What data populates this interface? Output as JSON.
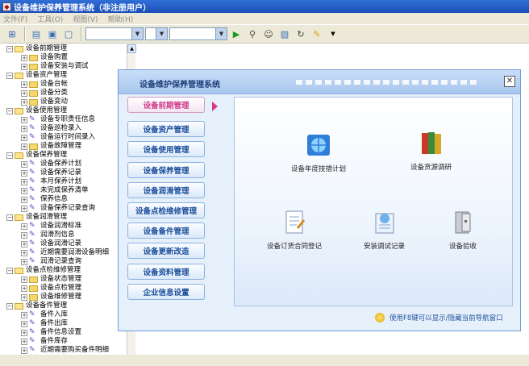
{
  "window": {
    "title": "设备维护保养管理系统（非注册用户）"
  },
  "menu": [
    "文件(F)",
    "工具(O)",
    "视图(V)",
    "帮助(H)"
  ],
  "toolbar": {
    "icons": [
      "tree-toggle-icon",
      "panel-icon",
      "window-icon",
      "monitor-icon",
      "play-icon",
      "user-search-icon",
      "users-icon",
      "photo-icon",
      "refresh-icon",
      "edit-icon"
    ]
  },
  "tree": [
    {
      "level": 0,
      "label": "设备前期管理",
      "open": true
    },
    {
      "level": 1,
      "label": "设备购置"
    },
    {
      "level": 1,
      "label": "设备安装与调试"
    },
    {
      "level": 0,
      "label": "设备资产管理",
      "open": true
    },
    {
      "level": 1,
      "label": "设备台帐"
    },
    {
      "level": 1,
      "label": "设备分类"
    },
    {
      "level": 1,
      "label": "设备变动"
    },
    {
      "level": 0,
      "label": "设备使用管理",
      "open": true
    },
    {
      "level": 1,
      "label": "设备专职责任信息",
      "pen": true
    },
    {
      "level": 1,
      "label": "设备巡检录入",
      "pen": true
    },
    {
      "level": 1,
      "label": "设备运行时间录入",
      "pen": true
    },
    {
      "level": 1,
      "label": "设备故障管理"
    },
    {
      "level": 0,
      "label": "设备保养管理",
      "open": true
    },
    {
      "level": 1,
      "label": "设备保养计划",
      "pen": true
    },
    {
      "level": 1,
      "label": "设备保养记录",
      "pen": true
    },
    {
      "level": 1,
      "label": "本月保养计划",
      "pen": true
    },
    {
      "level": 1,
      "label": "未完成保养清单",
      "pen": true
    },
    {
      "level": 1,
      "label": "保养信息",
      "pen": true
    },
    {
      "level": 1,
      "label": "设备保养记录查询",
      "pen": true
    },
    {
      "level": 0,
      "label": "设备润滑管理",
      "open": true
    },
    {
      "level": 1,
      "label": "设备润滑标准",
      "pen": true
    },
    {
      "level": 1,
      "label": "润滑剂信息",
      "pen": true
    },
    {
      "level": 1,
      "label": "设备润滑记录",
      "pen": true
    },
    {
      "level": 1,
      "label": "近期需要润滑设备明细",
      "pen": true
    },
    {
      "level": 1,
      "label": "润滑记录查询",
      "pen": true
    },
    {
      "level": 0,
      "label": "设备点检维修管理",
      "open": true
    },
    {
      "level": 1,
      "label": "设备状态管理"
    },
    {
      "level": 1,
      "label": "设备点检管理"
    },
    {
      "level": 1,
      "label": "设备维修管理"
    },
    {
      "level": 0,
      "label": "设备备件管理",
      "open": true
    },
    {
      "level": 1,
      "label": "备件入库",
      "pen": true
    },
    {
      "level": 1,
      "label": "备件出库",
      "pen": true
    },
    {
      "level": 1,
      "label": "备件信息设置",
      "pen": true
    },
    {
      "level": 1,
      "label": "备件库存",
      "pen": true
    },
    {
      "level": 1,
      "label": "近期需要购买备件明细",
      "pen": true
    },
    {
      "level": 0,
      "label": "设备更新改造",
      "open": false
    }
  ],
  "dialog": {
    "title": "设备维护保养管理系统",
    "nav": [
      {
        "label": "设备前期管理",
        "active": true
      },
      {
        "label": "设备资产管理"
      },
      {
        "label": "设备使用管理"
      },
      {
        "label": "设备保养管理"
      },
      {
        "label": "设备润滑管理"
      },
      {
        "label": "设备点检维修管理"
      },
      {
        "label": "设备备件管理"
      },
      {
        "label": "设备更新改造"
      },
      {
        "label": "设备资料管理"
      },
      {
        "label": "企业信息设置"
      }
    ],
    "functions": [
      {
        "label": "设备年度技措计划",
        "icon": "globe-icon"
      },
      {
        "label": "设备货源调研",
        "icon": "books-icon"
      },
      {
        "label": "设备订货合同登记",
        "icon": "document-icon"
      },
      {
        "label": "安装调试记录",
        "icon": "settings-doc-icon"
      },
      {
        "label": "设备验收",
        "icon": "cabinet-icon"
      }
    ],
    "hint": "使用F8键可以显示/隐藏当前导航窗口"
  }
}
